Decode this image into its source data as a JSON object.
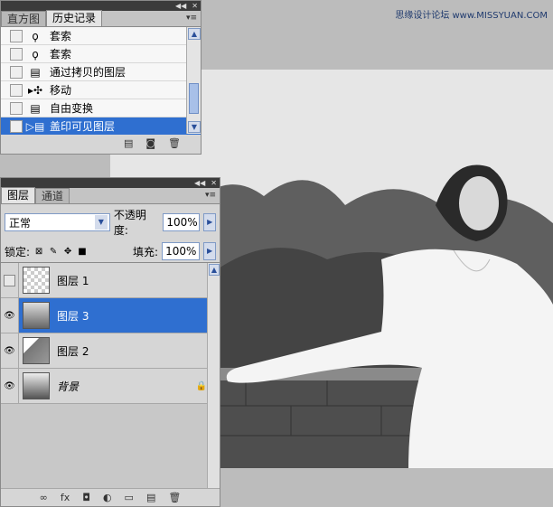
{
  "watermark": "思缘设计论坛 www.MISSYUAN.COM",
  "history_panel": {
    "tabs": [
      {
        "label": "直方图"
      },
      {
        "label": "历史记录"
      }
    ],
    "items": [
      {
        "label": "套索",
        "icon": "lasso-icon"
      },
      {
        "label": "套索",
        "icon": "lasso-icon"
      },
      {
        "label": "通过拷贝的图层",
        "icon": "history-doc-icon"
      },
      {
        "label": "移动",
        "icon": "move-icon"
      },
      {
        "label": "自由变换",
        "icon": "history-doc-icon"
      },
      {
        "label": "盖印可见图层",
        "icon": "history-doc-icon"
      }
    ],
    "selected_index": 5
  },
  "layers_panel": {
    "tabs": [
      {
        "label": "图层"
      },
      {
        "label": "通道"
      }
    ],
    "blend_mode": "正常",
    "opacity_label": "不透明度:",
    "opacity_value": "100%",
    "lock_label": "锁定:",
    "fill_label": "填充:",
    "fill_value": "100%",
    "layers": [
      {
        "name": "图层 1",
        "visible": false,
        "thumb": "transparent"
      },
      {
        "name": "图层 3",
        "visible": true,
        "thumb": "photo",
        "selected": true
      },
      {
        "name": "图层 2",
        "visible": true,
        "thumb": "mask"
      },
      {
        "name": "背景",
        "visible": true,
        "thumb": "photo",
        "locked": true
      }
    ]
  }
}
